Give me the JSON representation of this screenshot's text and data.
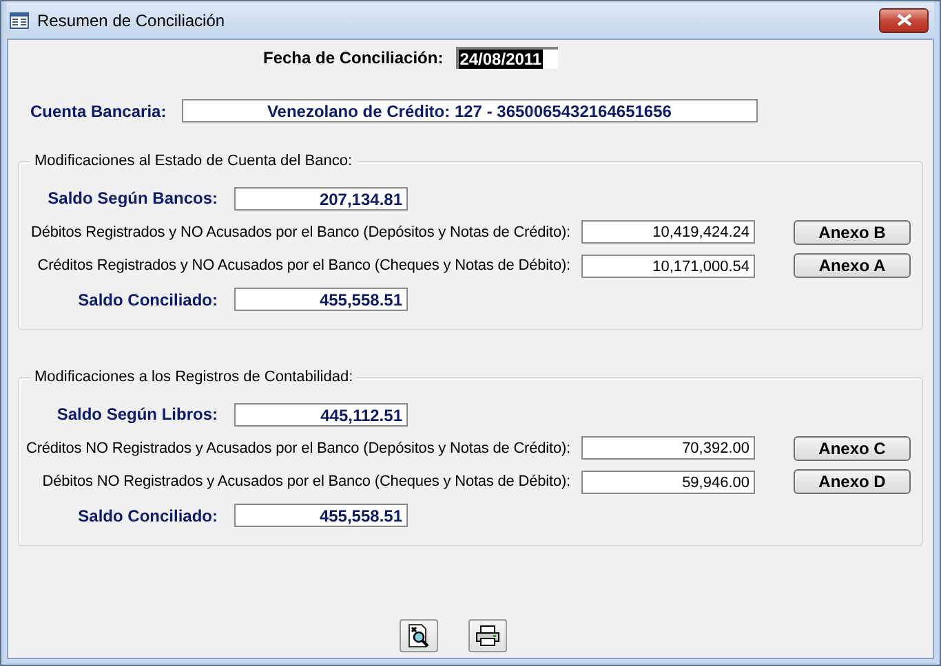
{
  "window": {
    "title": "Resumen de Conciliación"
  },
  "fecha": {
    "label": "Fecha de Conciliación:",
    "value": "24/08/2011",
    "selected": true
  },
  "cuenta": {
    "label": "Cuenta Bancaria:",
    "value": "Venezolano de Crédito: 127 - 3650065432164651656"
  },
  "sections": [
    {
      "title": "Modificaciones al Estado de Cuenta del Banco:",
      "rows": [
        {
          "kind": "total",
          "label": "Saldo Según Bancos:",
          "value": "207,134.81"
        },
        {
          "kind": "detail",
          "label": "Débitos Registrados y NO Acusados por el Banco (Depósitos y Notas de Crédito):",
          "value": "10,419,424.24",
          "button": "Anexo B"
        },
        {
          "kind": "detail",
          "label": "Créditos Registrados y NO Acusados por el Banco (Cheques y Notas de Débito):",
          "value": "10,171,000.54",
          "button": "Anexo A"
        },
        {
          "kind": "total",
          "label": "Saldo Conciliado:",
          "value": "455,558.51"
        }
      ]
    },
    {
      "title": "Modificaciones a los Registros de Contabilidad:",
      "rows": [
        {
          "kind": "total",
          "label": "Saldo Según Libros:",
          "value": "445,112.51"
        },
        {
          "kind": "detail",
          "label": "Créditos NO Registrados y  Acusados por el Banco (Depósitos y Notas de Crédito):",
          "value": "70,392.00",
          "button": "Anexo C"
        },
        {
          "kind": "detail",
          "label": "Débitos NO Registrados y Acusados por el Banco (Cheques y Notas de Débito):",
          "value": "59,946.00",
          "button": "Anexo D"
        },
        {
          "kind": "total",
          "label": "Saldo Conciliado:",
          "value": "455,558.51"
        }
      ]
    }
  ]
}
